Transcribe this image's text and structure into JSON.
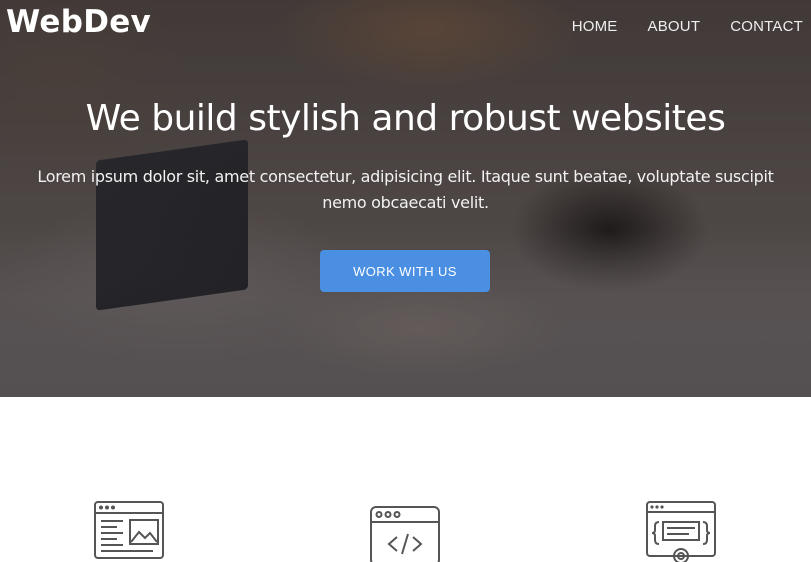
{
  "brand": {
    "logo_text": "WebDev"
  },
  "nav": {
    "items": [
      {
        "label": "HOME"
      },
      {
        "label": "ABOUT"
      },
      {
        "label": "CONTACT"
      }
    ]
  },
  "hero": {
    "title": "We build stylish and robust websites",
    "text": "Lorem ipsum dolor sit, amet consectetur, adipisicing elit. Itaque sunt beatae, voluptate suscipit nemo obcaecati velit.",
    "cta_label": "WORK WITH US",
    "cta_color": "#4a8fe2"
  },
  "features": {
    "icons": [
      {
        "name": "web-design-icon"
      },
      {
        "name": "code-icon"
      },
      {
        "name": "web-settings-icon"
      }
    ],
    "icon_color": "#555555"
  }
}
